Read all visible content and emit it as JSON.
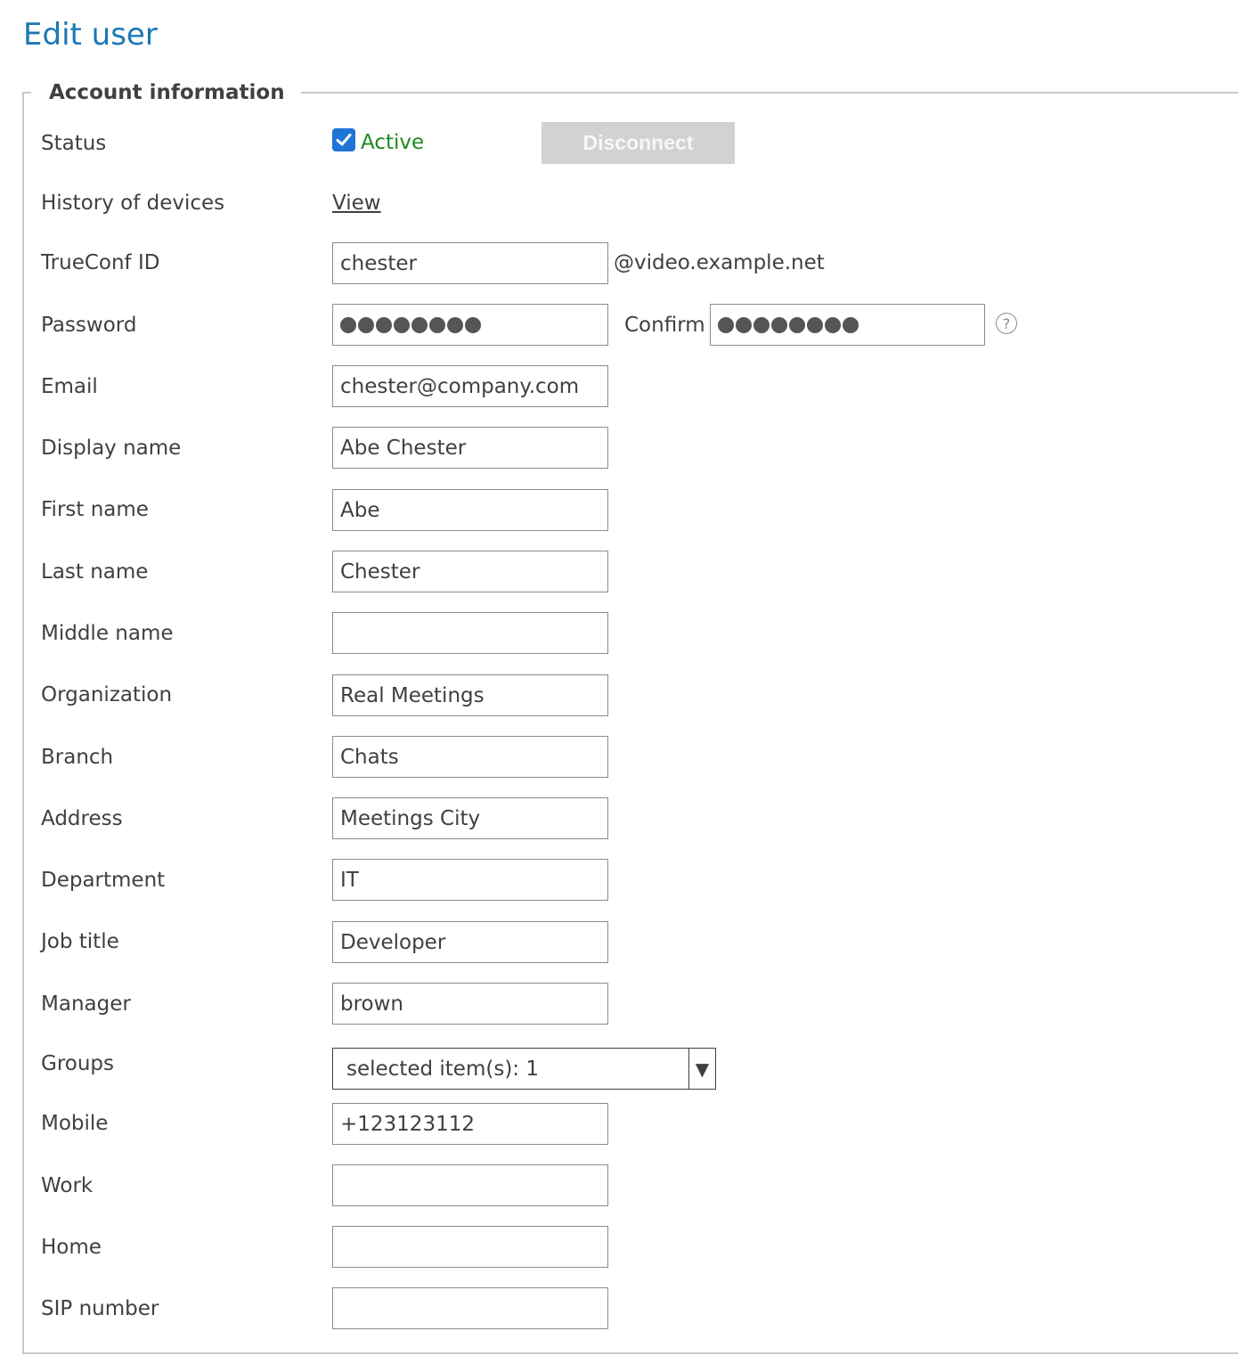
{
  "page": {
    "title": "Edit user"
  },
  "section": {
    "legend": "Account information"
  },
  "status": {
    "label": "Status",
    "active_label": "Active",
    "active_checked": true,
    "disconnect_label": "Disconnect"
  },
  "history": {
    "label": "History of devices",
    "link_text": "View"
  },
  "trueconf_id": {
    "label": "TrueConf ID",
    "value": "chester",
    "suffix": "@video.example.net"
  },
  "password": {
    "label": "Password",
    "masked_length": 8,
    "confirm_label": "Confirm",
    "confirm_masked_length": 8,
    "help_glyph": "?"
  },
  "fields": {
    "email": {
      "label": "Email",
      "value": "chester@company.com"
    },
    "display_name": {
      "label": "Display name",
      "value": "Abe Chester"
    },
    "first_name": {
      "label": "First name",
      "value": "Abe"
    },
    "last_name": {
      "label": "Last name",
      "value": "Chester"
    },
    "middle_name": {
      "label": "Middle name",
      "value": ""
    },
    "organization": {
      "label": "Organization",
      "value": "Real Meetings"
    },
    "branch": {
      "label": "Branch",
      "value": "Chats"
    },
    "address": {
      "label": "Address",
      "value": "Meetings City"
    },
    "department": {
      "label": "Department",
      "value": "IT"
    },
    "job_title": {
      "label": "Job title",
      "value": "Developer"
    },
    "manager": {
      "label": "Manager",
      "value": "brown"
    },
    "mobile": {
      "label": "Mobile",
      "value": "+123123112"
    },
    "work": {
      "label": "Work",
      "value": ""
    },
    "home": {
      "label": "Home",
      "value": ""
    },
    "sip_number": {
      "label": "SIP number",
      "value": ""
    }
  },
  "groups": {
    "label": "Groups",
    "selected_text": "selected item(s): 1",
    "arrow_glyph": "▼"
  },
  "colors": {
    "title": "#1a78b4",
    "active": "#1b8a1b",
    "checkbox": "#1f74d6",
    "disabled_button": "#d2d2d2"
  },
  "icons": {
    "checkbox": "checkmark-icon",
    "help": "question-circle-icon",
    "dropdown": "triangle-down-icon"
  }
}
